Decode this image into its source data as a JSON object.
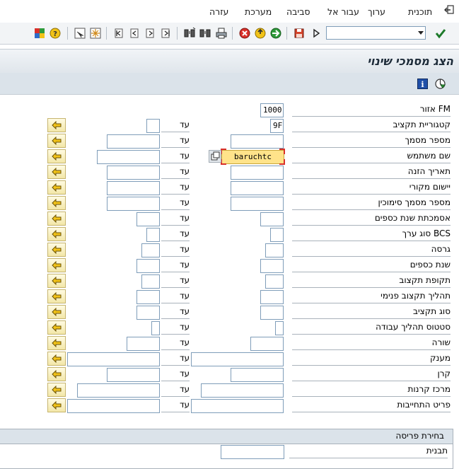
{
  "menu": {
    "program": "תוכנית",
    "edit": "ערוך",
    "goto": "עבור אל",
    "environment": "סביבה",
    "system": "מערכת",
    "help": "עזרה"
  },
  "page_title": "הצג מסמכי שינוי",
  "to_label": "עד",
  "fields": [
    {
      "label": "אזור FM",
      "from": "1000",
      "to": null
    },
    {
      "label": "קטגוריית תקציב",
      "from": "9F",
      "to": ""
    },
    {
      "label": "מספר מסמך",
      "from": "",
      "to": ""
    },
    {
      "label": "שם משתמש",
      "from": "baruchtc",
      "to": ""
    },
    {
      "label": "תאריך הזנה",
      "from": "",
      "to": ""
    },
    {
      "label": "יישום מקורי",
      "from": "",
      "to": ""
    },
    {
      "label": "מספר מסמך סימוכין",
      "from": "",
      "to": ""
    },
    {
      "label": "אסמכתת שנת כספים",
      "from": "",
      "to": ""
    },
    {
      "label": "סוג ערך BCS",
      "from": "",
      "to": ""
    },
    {
      "label": "גרסה",
      "from": "",
      "to": ""
    },
    {
      "label": "שנת כספים",
      "from": "",
      "to": ""
    },
    {
      "label": "תקופת תקצוב",
      "from": "",
      "to": ""
    },
    {
      "label": "תהליך תקצוב פנימי",
      "from": "",
      "to": ""
    },
    {
      "label": "סוג תקציב",
      "from": "",
      "to": ""
    },
    {
      "label": "סטטוס תהליך עבודה",
      "from": "",
      "to": ""
    },
    {
      "label": "שורה",
      "from": "",
      "to": ""
    },
    {
      "label": "מענק",
      "from": "",
      "to": ""
    },
    {
      "label": "קרן",
      "from": "",
      "to": ""
    },
    {
      "label": "מרכז קרנות",
      "from": "",
      "to": ""
    },
    {
      "label": "פריט התחייבות",
      "from": "",
      "to": ""
    }
  ],
  "layout_section": {
    "title": "בחירת פריסה",
    "label": "תבנית",
    "value": ""
  },
  "colors": {
    "focus_field": "#ffe38a",
    "header_band": "#dbe3ea",
    "select_button": "#f3e7a8"
  },
  "icons": [
    "exit-icon",
    "enter-icon",
    "save-icon",
    "back-icon",
    "exit-app-icon",
    "cancel-icon",
    "print-icon",
    "find-icon",
    "find-next-icon",
    "first-page-icon",
    "previous-page-icon",
    "next-page-icon",
    "last-page-icon",
    "create-session-icon",
    "shortcut-icon",
    "customize-layout-icon",
    "help-icon",
    "info-icon",
    "execute-icon",
    "multiple-selection-icon",
    "arrow-left-icon"
  ]
}
